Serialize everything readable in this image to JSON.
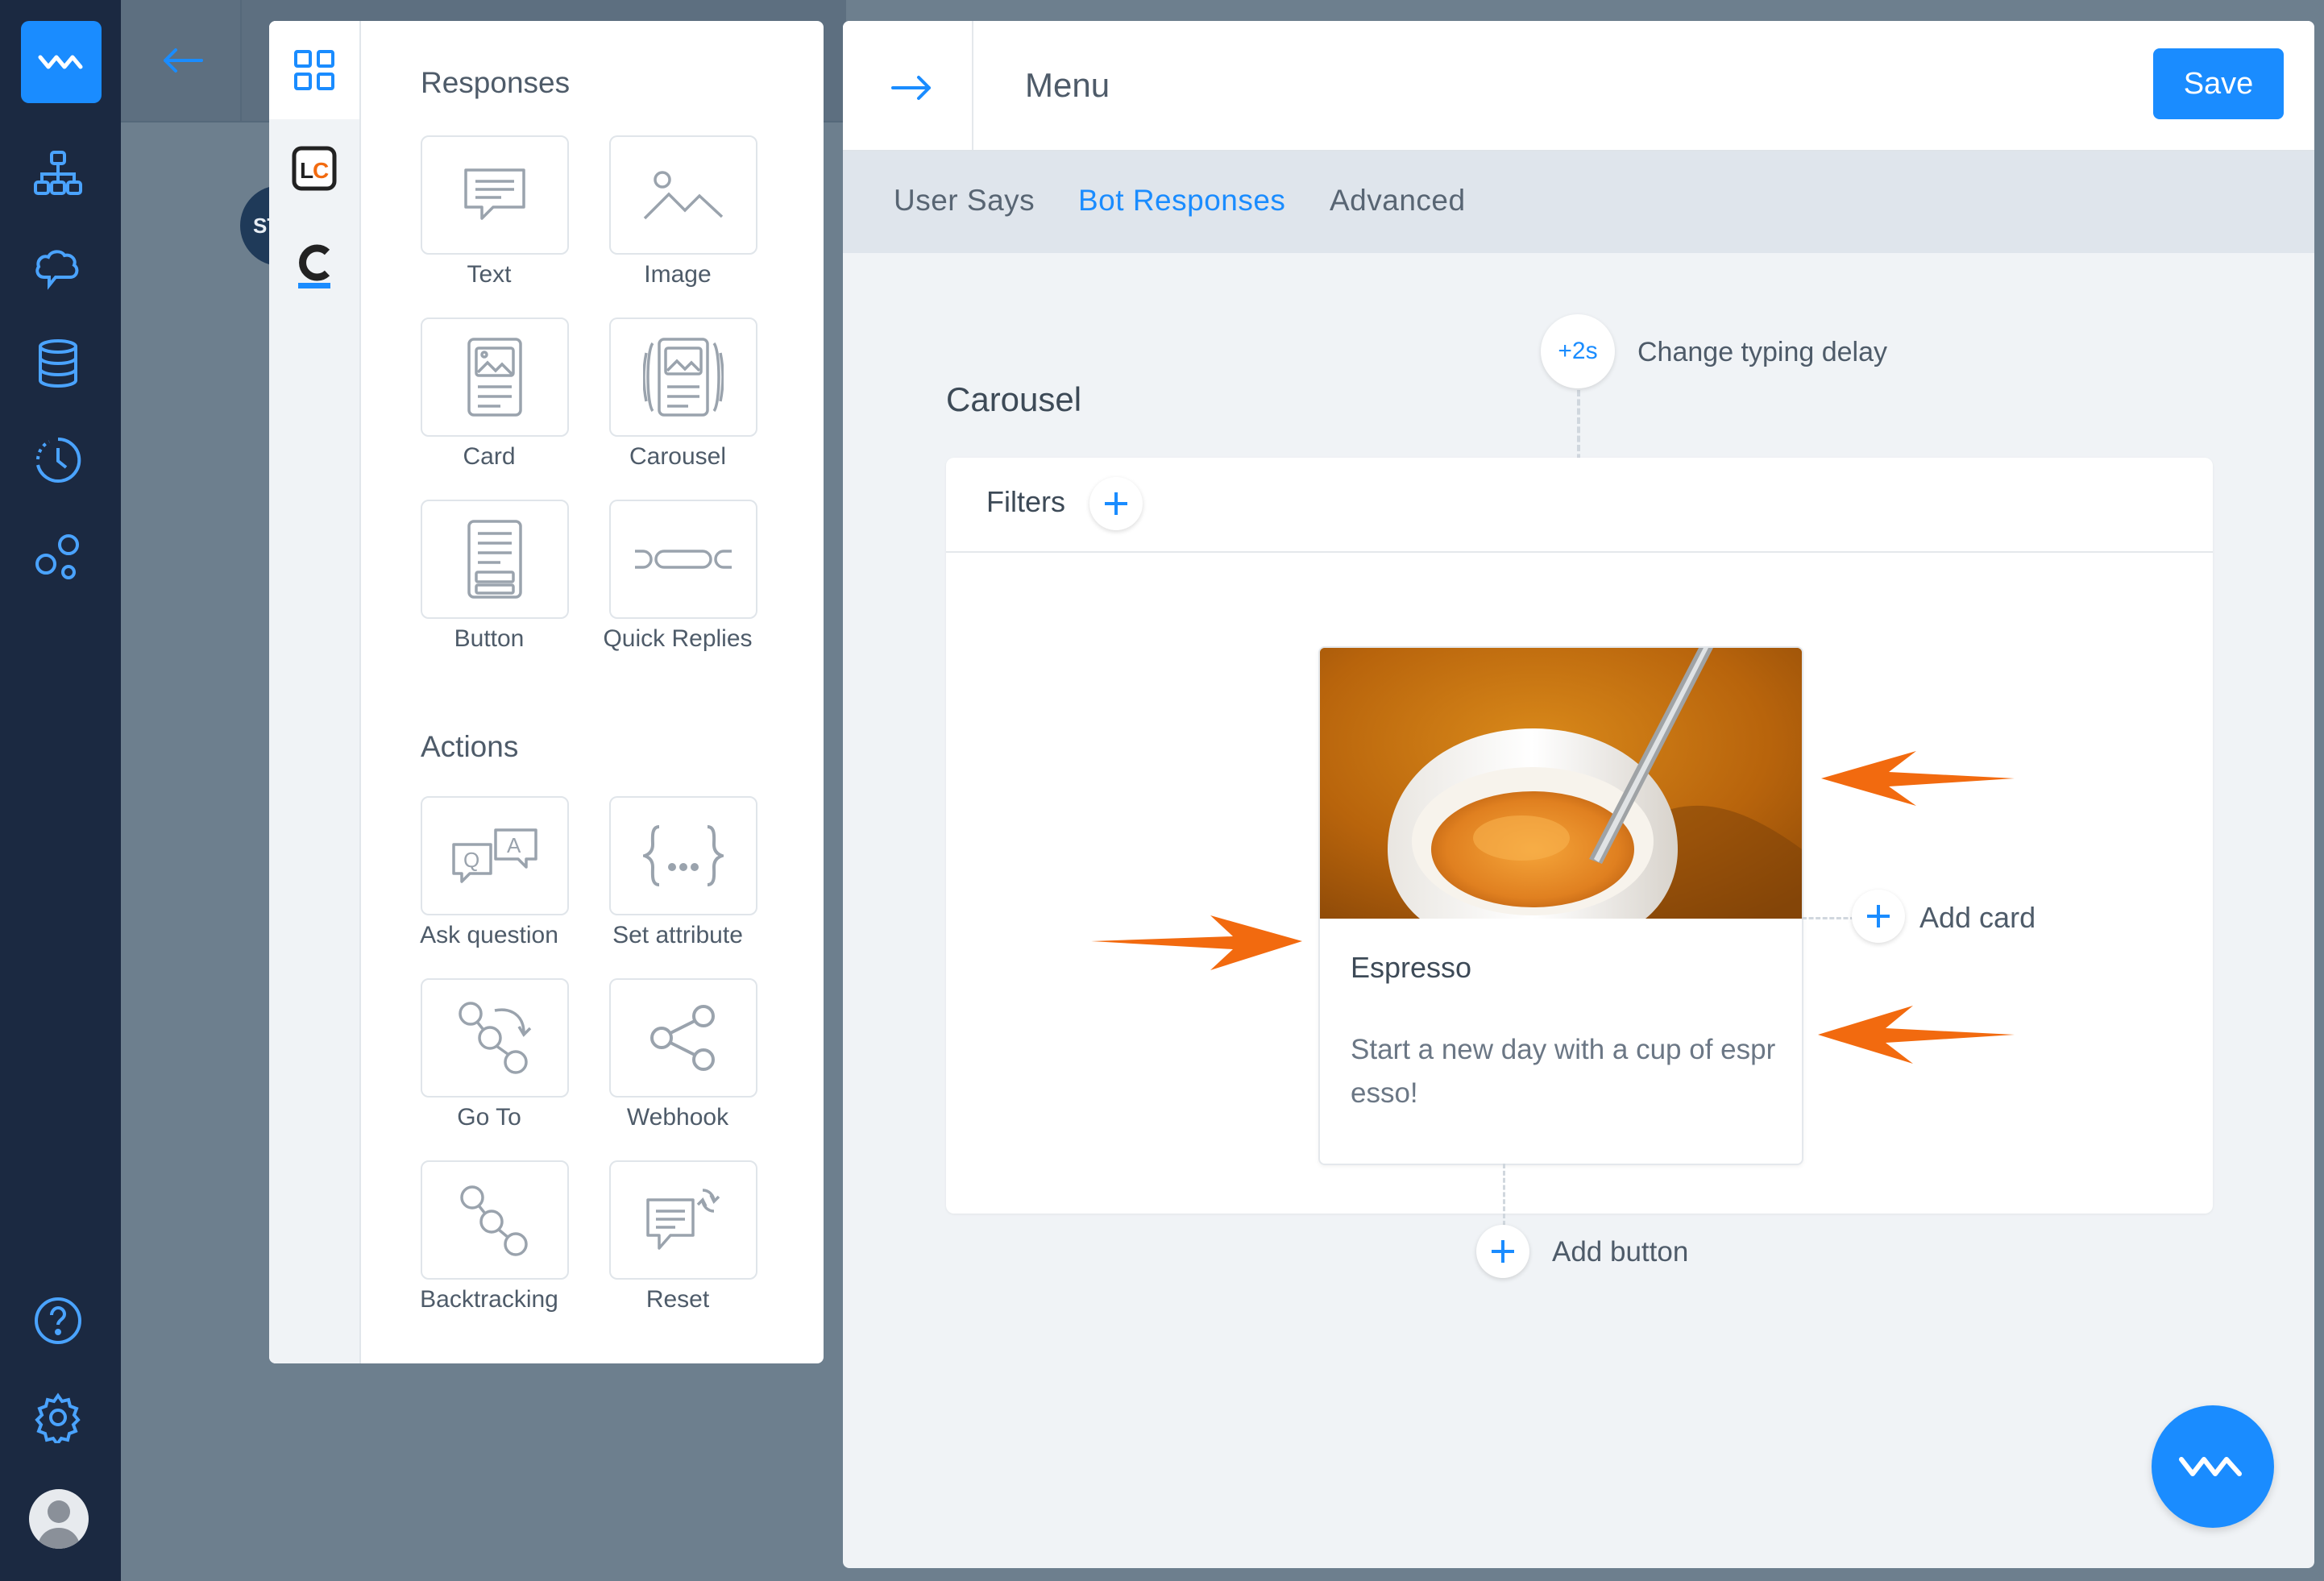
{
  "rail": {
    "icons": [
      "logo-wave-icon",
      "flow-tree-icon",
      "cloud-brain-icon",
      "database-icon",
      "clock-history-icon",
      "bubbles-icon",
      "help-icon",
      "settings-icon",
      "avatar"
    ]
  },
  "background": {
    "node_label": "ST"
  },
  "palette": {
    "tabs": [
      "grid-icon",
      "livechat-lc-icon",
      "chatbot-c-icon"
    ],
    "responses_title": "Responses",
    "responses": [
      {
        "label": "Text",
        "icon": "text-message-icon"
      },
      {
        "label": "Image",
        "icon": "image-icon"
      },
      {
        "label": "Card",
        "icon": "card-icon"
      },
      {
        "label": "Carousel",
        "icon": "carousel-icon"
      },
      {
        "label": "Button",
        "icon": "button-icon"
      },
      {
        "label": "Quick Replies",
        "icon": "quick-replies-icon"
      }
    ],
    "actions_title": "Actions",
    "actions": [
      {
        "label": "Ask question",
        "icon": "qa-icon"
      },
      {
        "label": "Set attribute",
        "icon": "braces-icon"
      },
      {
        "label": "Go To",
        "icon": "goto-icon"
      },
      {
        "label": "Webhook",
        "icon": "share-icon"
      },
      {
        "label": "Backtracking",
        "icon": "backtracking-icon"
      },
      {
        "label": "Reset",
        "icon": "reset-icon"
      }
    ]
  },
  "editor": {
    "title": "Menu",
    "save_label": "Save",
    "tabs": [
      "User Says",
      "Bot Responses",
      "Advanced"
    ],
    "active_tab": "Bot Responses",
    "typing_delay": "+2s",
    "typing_label": "Change typing delay",
    "section_title": "Carousel",
    "filters_label": "Filters",
    "card": {
      "title": "Espresso",
      "subtitle": "Start a new day with a cup of espresso!"
    },
    "add_card_label": "Add card",
    "add_button_label": "Add button"
  },
  "colors": {
    "accent": "#1a8cff",
    "rail": "#1b2941",
    "annotation_arrow": "#f26a0f"
  }
}
